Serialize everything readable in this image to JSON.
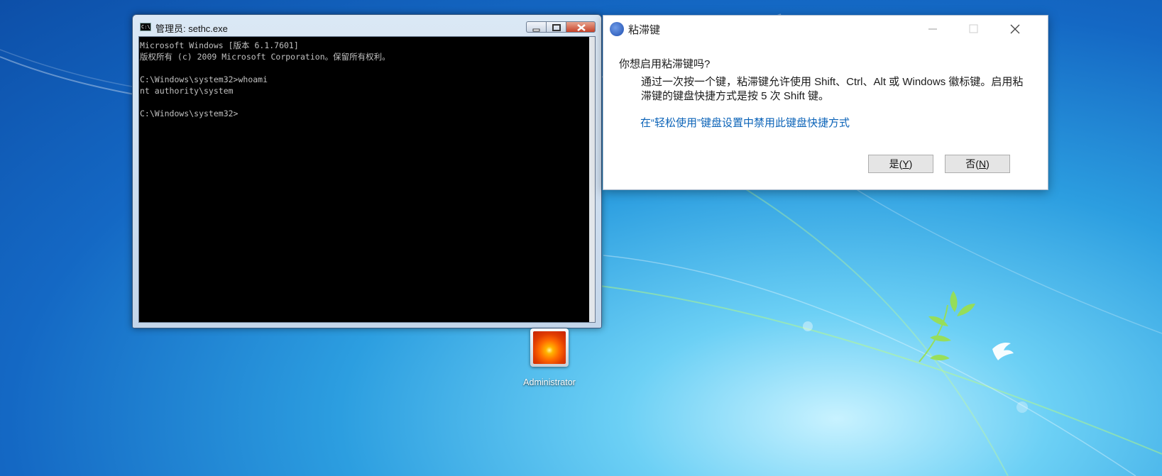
{
  "cmd_window": {
    "title": "管理员: sethc.exe",
    "icon_text": "C:\\",
    "console_lines": [
      "Microsoft Windows [版本 6.1.7601]",
      "版权所有 (c) 2009 Microsoft Corporation。保留所有权利。",
      "",
      "C:\\Windows\\system32>whoami",
      "nt authority\\system",
      "",
      "C:\\Windows\\system32>"
    ]
  },
  "dialog": {
    "title": "粘滞键",
    "question": "你想启用粘滞键吗?",
    "description": "通过一次按一个键，粘滞键允许使用 Shift、Ctrl、Alt 或 Windows 徽标键。启用粘滞键的键盘快捷方式是按 5 次 Shift 键。",
    "link": "在“轻松使用”键盘设置中禁用此键盘快捷方式",
    "yes_text": "是(",
    "yes_key": "Y",
    "no_text": "否(",
    "no_key": "N",
    "close_paren": ")"
  },
  "desktop": {
    "user_label": "Administrator"
  }
}
